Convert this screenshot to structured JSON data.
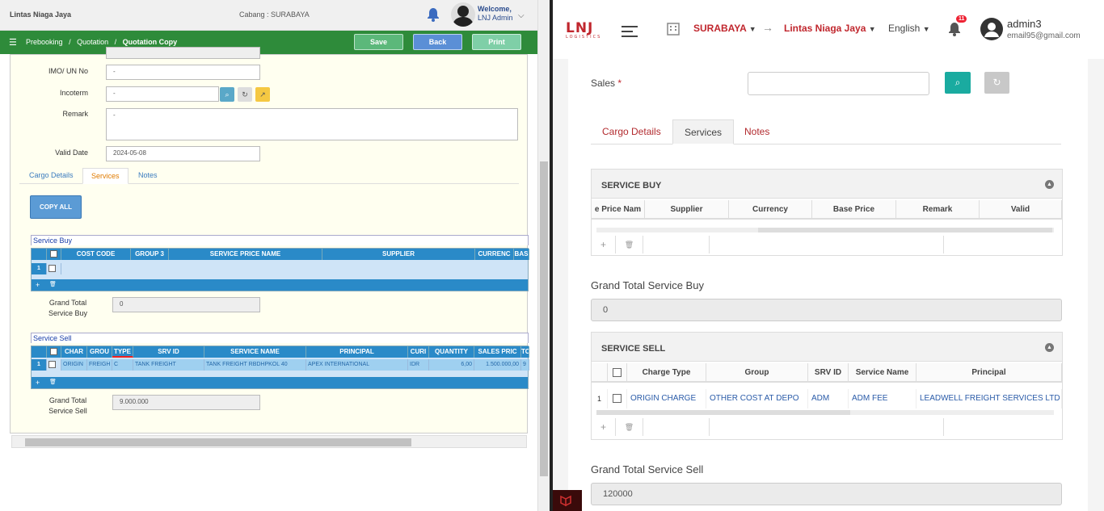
{
  "left": {
    "app_title": "Lintas Niaga Jaya",
    "branch_label": "Cabang :",
    "branch": "SURABAYA",
    "welcome": "Welcome,",
    "user": "LNJ Admin",
    "breadcrumb": [
      "Prebooking",
      "/",
      "Quotation",
      "/",
      "Quotation Copy"
    ],
    "buttons": {
      "save": "Save",
      "back": "Back",
      "print": "Print"
    },
    "form": {
      "imo_label": "IMO/ UN No",
      "imo_value": "-",
      "incoterm_label": "Incoterm",
      "incoterm_value": "-",
      "remark_label": "Remark",
      "remark_value": "-",
      "valid_label": "Valid Date",
      "valid_value": "2024-05-08"
    },
    "tabs": [
      "Cargo Details",
      "Services",
      "Notes"
    ],
    "copy_all": "COPY ALL",
    "service_buy": {
      "title": "Service Buy",
      "headers": [
        "COST CODE",
        "GROUP 3",
        "SERVICE PRICE NAME",
        "SUPPLIER",
        "CURRENC",
        "BAS"
      ],
      "row_num": "1",
      "total_label_1": "Grand Total",
      "total_label_2": "Service Buy",
      "total": "0"
    },
    "service_sell": {
      "title": "Service Sell",
      "headers": [
        "CHAR",
        "GROU",
        "TYPE",
        "SRV ID",
        "SERVICE NAME",
        "PRINCIPAL",
        "CURI",
        "QUANTITY",
        "SALES PRIC",
        "TO"
      ],
      "row": {
        "num": "1",
        "charge": "ORIGIN",
        "group": "FREIGH",
        "type": "C",
        "srv_id": "TANK FREIGHT",
        "service_name": "TANK FREIGHT RBDHPKOL 40",
        "principal": "APEX INTERNATIONAL",
        "currency": "IDR",
        "quantity": "6,00",
        "sales_price": "1.500.000,00",
        "total": "9"
      },
      "total_label_1": "Grand Total",
      "total_label_2": "Service Sell",
      "total": "9.000.000"
    },
    "footer_add": "+",
    "footer_del": "🗑"
  },
  "right": {
    "logo": "LNJ",
    "logo_sub": "LOGISTICS",
    "city": "SURABAYA",
    "company": "Lintas Niaga Jaya",
    "language": "English",
    "notif_count": "11",
    "username": "admin3",
    "email": "email95@gmail.com",
    "sales_label": "Sales",
    "required_mark": "*",
    "tabs": [
      "Cargo Details",
      "Services",
      "Notes"
    ],
    "service_buy": {
      "title": "SERVICE BUY",
      "headers": [
        "e Price Nam",
        "Supplier",
        "Currency",
        "Base Price",
        "Remark",
        "Valid"
      ],
      "total_label": "Grand Total Service Buy",
      "total": "0"
    },
    "service_sell": {
      "title": "SERVICE SELL",
      "headers": [
        "Charge Type",
        "Group",
        "SRV ID",
        "Service Name",
        "Principal"
      ],
      "row": {
        "num": "1",
        "charge_type": "ORIGIN CHARGE",
        "group": "OTHER COST AT DEPO",
        "srv_id": "ADM",
        "service_name": "ADM FEE",
        "principal": "LEADWELL FREIGHT SERVICES LTD"
      },
      "total_label": "Grand Total Service Sell",
      "total": "120000"
    },
    "footer_add": "+",
    "footer_del": "🗑"
  },
  "colors": {
    "brand_red": "#c0262d",
    "green_bar": "#2e8b3a",
    "grid_header": "#2a8ac8",
    "teal": "#1aaba0"
  }
}
